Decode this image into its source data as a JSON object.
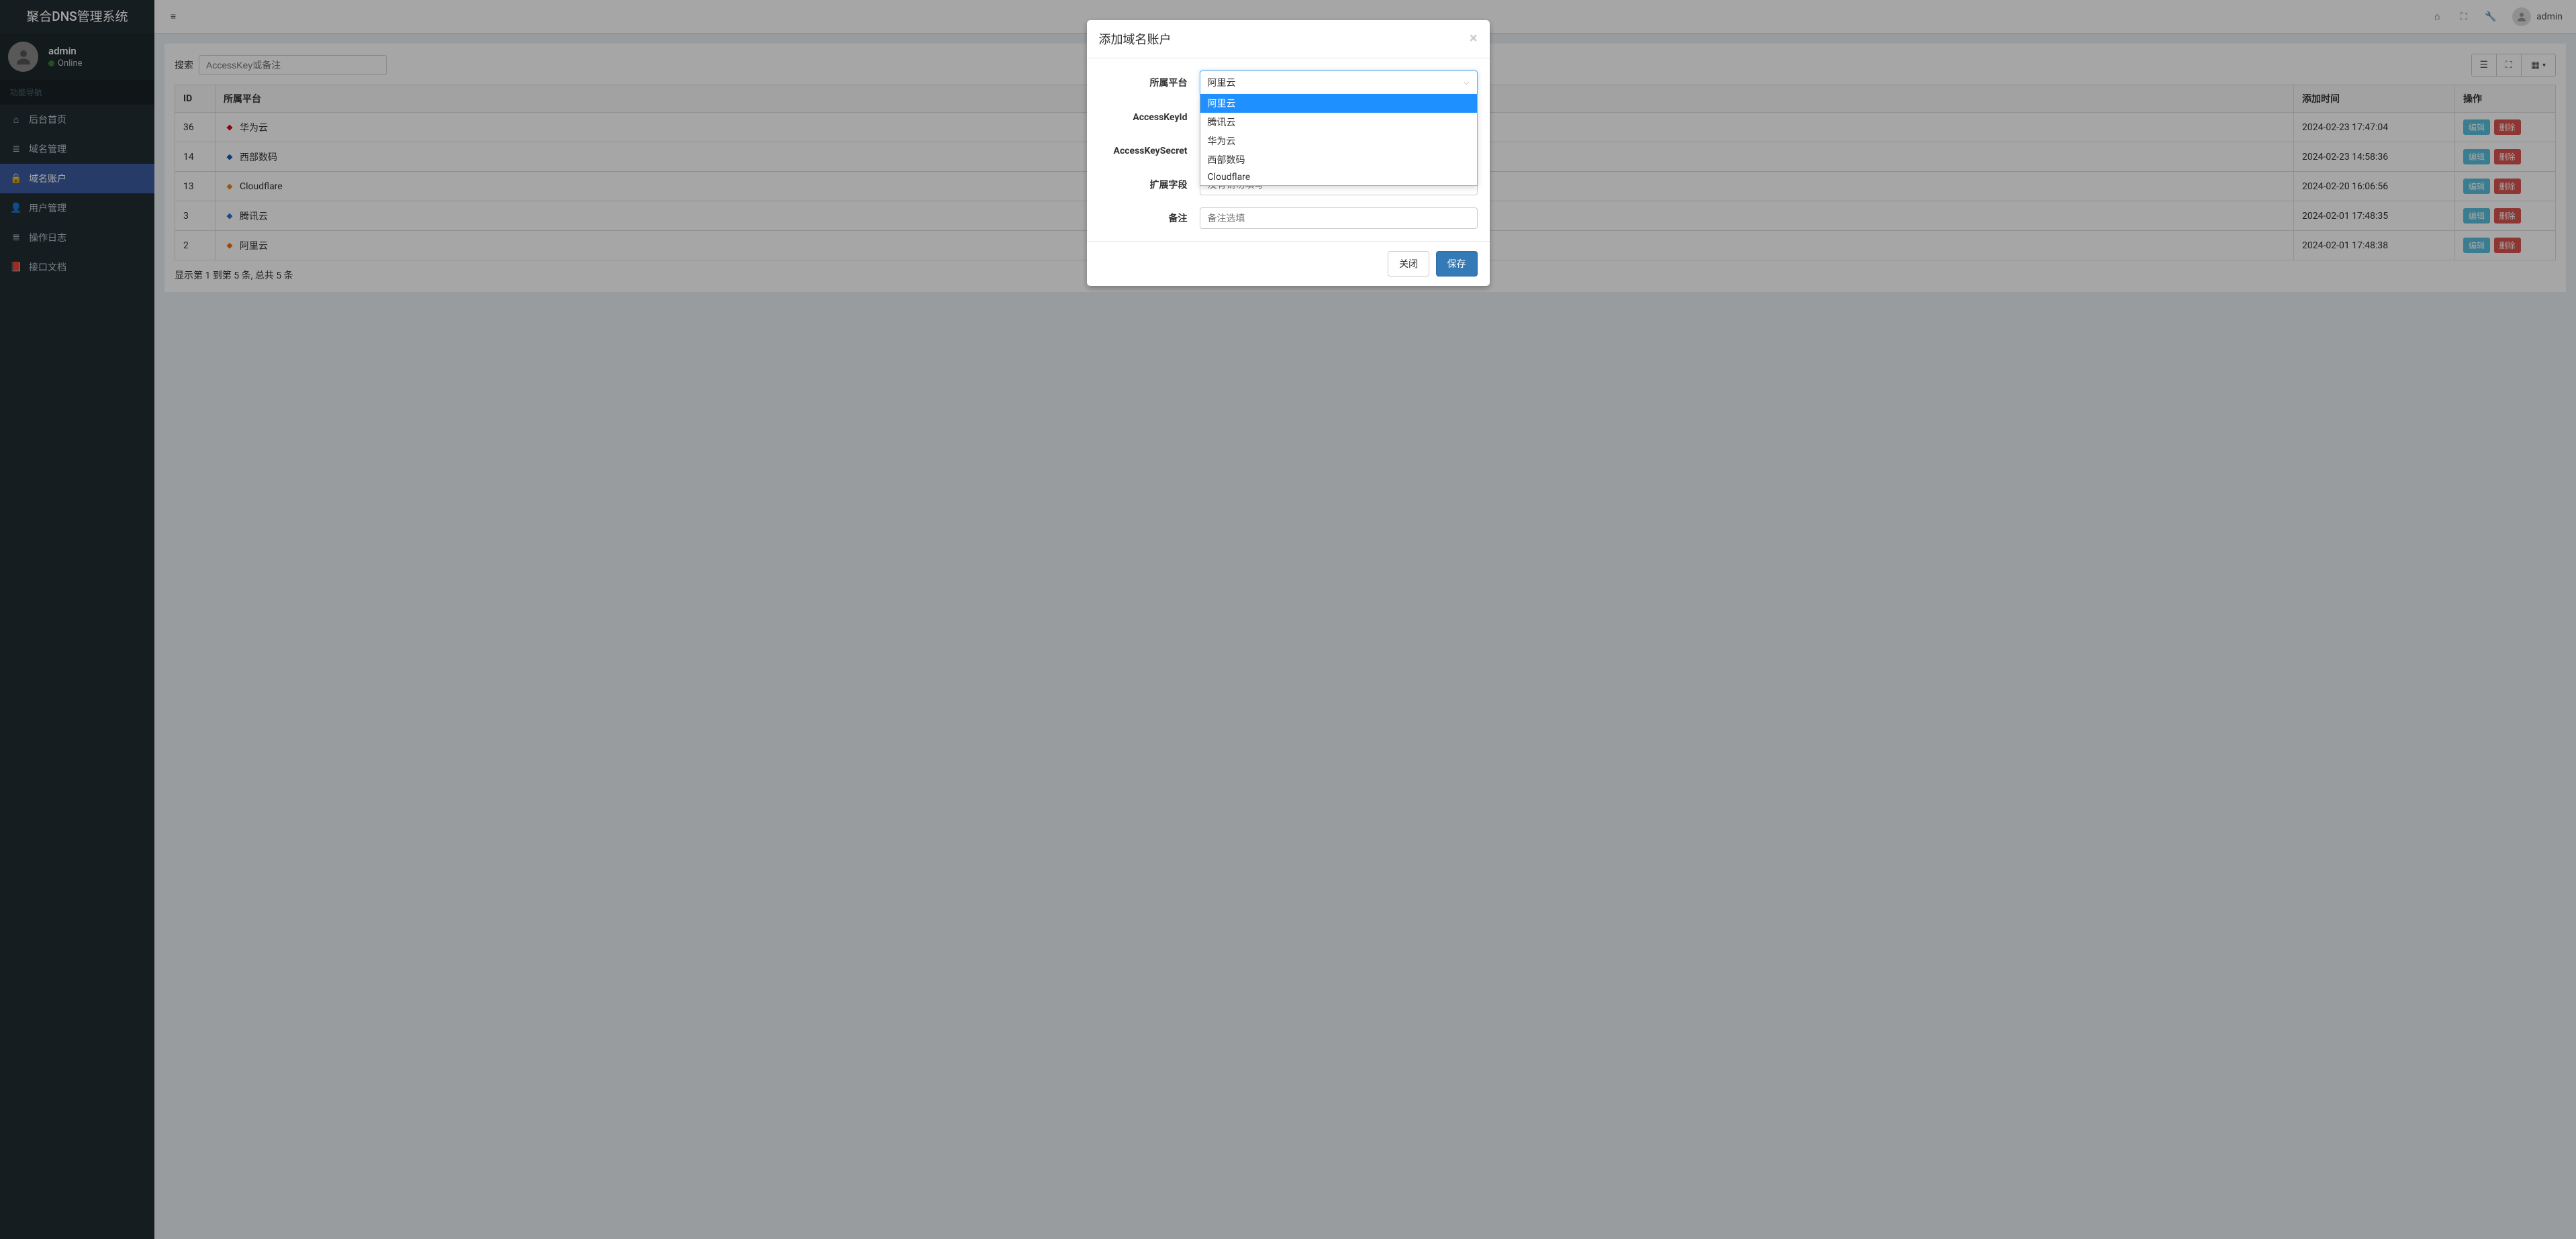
{
  "app": {
    "brand": "聚合DNS管理系统"
  },
  "user": {
    "name": "admin",
    "status_label": "Online",
    "navbar_name": "admin"
  },
  "sidebar": {
    "section_label": "功能导航",
    "items": [
      {
        "icon": "home",
        "label": "后台首页"
      },
      {
        "icon": "list",
        "label": "域名管理"
      },
      {
        "icon": "lock",
        "label": "域名账户",
        "active": true
      },
      {
        "icon": "user",
        "label": "用户管理"
      },
      {
        "icon": "log",
        "label": "操作日志"
      },
      {
        "icon": "book",
        "label": "接口文档"
      }
    ]
  },
  "search": {
    "label": "搜索",
    "placeholder": "AccessKey或备注"
  },
  "table": {
    "columns": {
      "id": "ID",
      "platform": "所属平台",
      "add_time": "添加时间",
      "action": "操作"
    },
    "rows": [
      {
        "id": "36",
        "platform": "华为云",
        "icon_color": "#e60012",
        "add_time": "2024-02-23 17:47:04"
      },
      {
        "id": "14",
        "platform": "西部数码",
        "icon_color": "#1a5fb4",
        "add_time": "2024-02-23 14:58:36"
      },
      {
        "id": "13",
        "platform": "Cloudflare",
        "icon_color": "#f6821f",
        "add_time": "2024-02-20 16:06:56"
      },
      {
        "id": "3",
        "platform": "腾讯云",
        "icon_color": "#2971d7",
        "add_time": "2024-02-01 17:48:35"
      },
      {
        "id": "2",
        "platform": "阿里云",
        "icon_color": "#ff6a00",
        "add_time": "2024-02-01 17:48:38"
      }
    ],
    "action_edit": "编辑",
    "action_delete": "删除",
    "footer": "显示第 1 到第 5 条, 总共 5 条"
  },
  "modal": {
    "title": "添加域名账户",
    "fields": {
      "platform_label": "所属平台",
      "platform_selected": "阿里云",
      "access_key_id_label": "AccessKeyId",
      "access_key_secret_label": "AccessKeySecret",
      "ext_label": "扩展字段",
      "ext_placeholder": "没有请勿填写",
      "remark_label": "备注",
      "remark_placeholder": "备注选填"
    },
    "platform_options": [
      "阿里云",
      "腾讯云",
      "华为云",
      "西部数码",
      "Cloudflare"
    ],
    "close_label": "关闭",
    "save_label": "保存"
  }
}
